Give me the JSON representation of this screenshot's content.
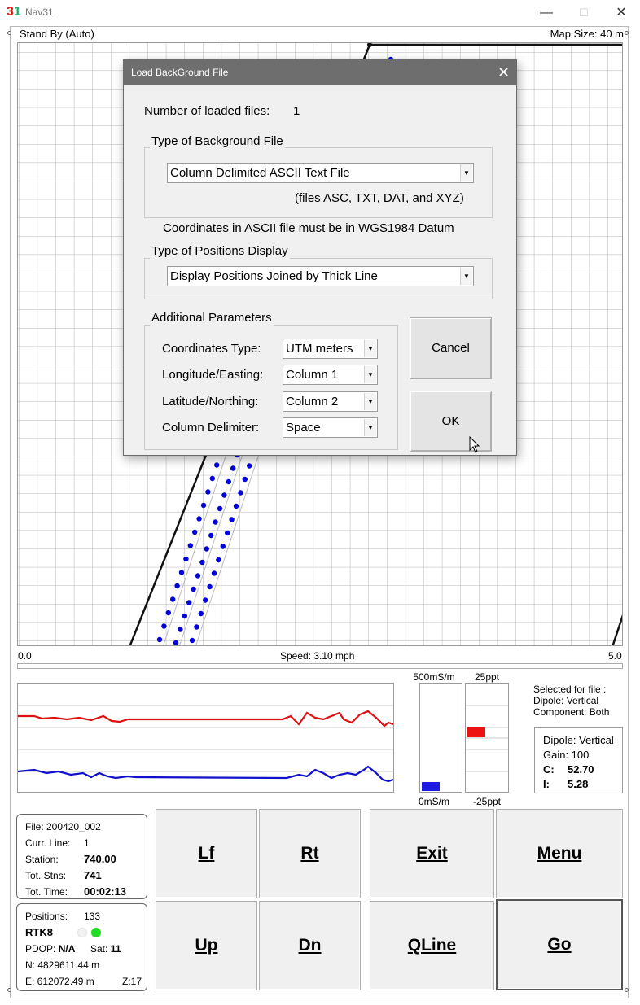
{
  "window": {
    "title": "Nav31",
    "icon_text_a": "3",
    "icon_text_b": "1",
    "minimize": "—",
    "maximize": "☐",
    "close": "✕"
  },
  "status": {
    "mode": "Stand By (Auto)",
    "map_size": "Map Size:   40 m"
  },
  "speed": {
    "min_label": "0.0",
    "max_label": "5.0",
    "text": "Speed:  3.10 mph"
  },
  "meters": {
    "conductivity_top": "500mS/m",
    "conductivity_bottom": "0mS/m",
    "inphase_top": "25ppt",
    "inphase_bottom": "-25ppt"
  },
  "selected": {
    "line1": "Selected for file :",
    "line2": " Dipole: Vertical",
    "line3": " Component: Both"
  },
  "dipole_box": {
    "dipole": "Dipole: Vertical",
    "gain": "Gain:   100",
    "c_label": "C:",
    "c_value": "52.70",
    "i_label": "I:",
    "i_value": "5.28"
  },
  "file_info": {
    "file": "File: 200420_002",
    "curr_line_label": "Curr. Line:",
    "curr_line_value": "1",
    "station_label": "Station:",
    "station_value": "740.00",
    "tot_stns_label": "Tot. Stns:",
    "tot_stns_value": "741",
    "tot_time_label": "Tot. Time:",
    "tot_time_value": "00:02:13"
  },
  "gps_info": {
    "positions_label": "Positions:",
    "positions_value": "133",
    "fix": "RTK8",
    "pdop_label": "PDOP:",
    "pdop_value": "N/A",
    "sat_label": "Sat:",
    "sat_value": "11",
    "northing": "N:  4829611.44 m",
    "easting": "E:   612072.49 m",
    "zone": "Z:17",
    "status_colors": [
      "#f2f2f2",
      "#22dd22"
    ]
  },
  "buttons": {
    "lf": "Lf",
    "rt": "Rt",
    "exit": "Exit",
    "menu": "Menu",
    "up": "Up",
    "dn": "Dn",
    "qline": "QLine",
    "go": "Go"
  },
  "dialog": {
    "title": "Load BackGround File",
    "close": "✕",
    "loaded_label": "Number of loaded files:",
    "loaded_value": "1",
    "type_group": "Type of Background File",
    "type_value": "Column Delimited ASCII Text File",
    "type_hint": "(files ASC, TXT, DAT, and XYZ)",
    "datum_note": "Coordinates in ASCII file must be in WGS1984 Datum",
    "display_group": "Type of Positions Display",
    "display_value": "Display Positions Joined by Thick Line",
    "params_group": "Additional Parameters",
    "coord_type_label": "Coordinates Type:",
    "coord_type_value": "UTM meters",
    "lon_label": "Longitude/Easting:",
    "lon_value": "Column 1",
    "lat_label": "Latitude/Northing:",
    "lat_value": "Column 2",
    "delim_label": "Column Delimiter:",
    "delim_value": "Space",
    "cancel": "Cancel",
    "ok": "OK"
  },
  "colors": {
    "track_dots": "#0000dd",
    "conductivity_trace": "#dd1111",
    "inphase_trace": "#1111cc",
    "dialog_titlebar": "#6e6e6e"
  }
}
